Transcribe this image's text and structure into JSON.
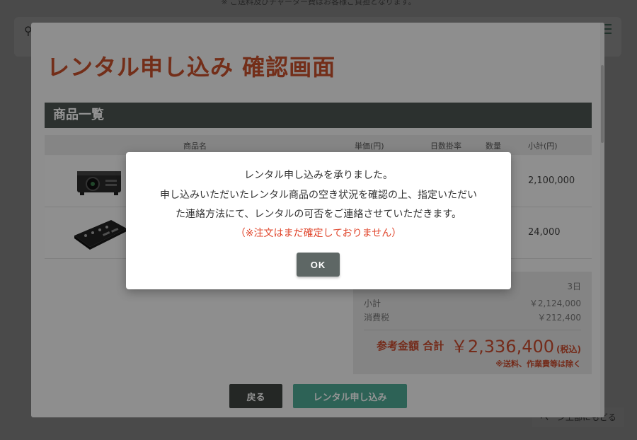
{
  "background": {
    "top_note": "※ ご送料及びチャーター費はお客様ご負担となります。",
    "back_to_top": "ページ上部にもどる"
  },
  "modal": {
    "title": "レンタル申し込み 確認画面",
    "section_title": "商品一覧",
    "table_headers": {
      "name": "商品名",
      "unit_price": "単価(円)",
      "days_rate": "日数掛率",
      "quantity": "数量",
      "subtotal": "小計(円)"
    },
    "rows": [
      {
        "image": "projector-image",
        "subtotal": "2,100,000"
      },
      {
        "image": "video-switcher-image",
        "subtotal": "24,000"
      }
    ],
    "summary": {
      "days": "3日",
      "subtotal_label": "小計",
      "subtotal_value": "￥2,124,000",
      "tax_label": "消費税",
      "tax_value": "￥212,400",
      "total_label": "参考金額 合計",
      "total_value": "￥2,336,400",
      "tax_included": "(税込)",
      "note": "※送料、作業費等は除く"
    },
    "buttons": {
      "back": "戻る",
      "apply": "レンタル申し込み"
    }
  },
  "dialog": {
    "line1": "レンタル申し込みを承りました。",
    "line2": "申し込みいただいたレンタル商品の空き状況を確認の上、指定いただい",
    "line3": "た連絡方法にて、レンタルの可否をご連絡させていただきます。",
    "warning": "（※注文はまだ確定しておりません）",
    "ok_label": "OK"
  },
  "colors": {
    "accent_red": "#c6502b",
    "teal": "#4ea995",
    "dark": "#4c5552"
  }
}
